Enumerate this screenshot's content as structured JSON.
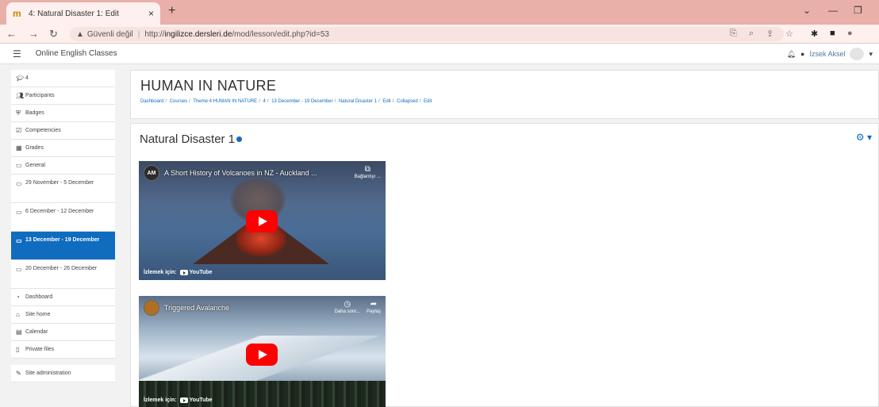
{
  "browser": {
    "tab_title": "4: Natural Disaster 1: Edit",
    "tab_close": "×",
    "new_tab": "+",
    "url_warning": "Güvenli değil",
    "url_prefix": "http://",
    "url_host": "ingilizce.dersleri.de",
    "url_path": "/mod/lesson/edit.php?id=53"
  },
  "navbar": {
    "site_name": "Online English Classes",
    "user_name": "İzsek Aksel"
  },
  "sidebar": {
    "items": [
      {
        "label": "4",
        "icon": "graduation-cap-icon"
      },
      {
        "label": "Participants",
        "icon": "users-icon"
      },
      {
        "label": "Badges",
        "icon": "shield-icon"
      },
      {
        "label": "Competencies",
        "icon": "check-square-icon"
      },
      {
        "label": "Grades",
        "icon": "table-icon"
      },
      {
        "label": "General",
        "icon": "folder-icon"
      },
      {
        "label": "29 November - 5 December",
        "icon": "folder-icon"
      },
      {
        "label": "6 December - 12 December",
        "icon": "folder-icon"
      },
      {
        "label": "13 December - 19 December",
        "icon": "folder-icon"
      },
      {
        "label": "20 December - 26 December",
        "icon": "folder-icon"
      },
      {
        "label": "Dashboard",
        "icon": "dashboard-icon"
      },
      {
        "label": "Site home",
        "icon": "home-icon"
      },
      {
        "label": "Calendar",
        "icon": "calendar-icon"
      },
      {
        "label": "Private files",
        "icon": "file-icon"
      },
      {
        "label": "Site administration",
        "icon": "wrench-icon"
      }
    ]
  },
  "header": {
    "title": "HUMAN IN NATURE",
    "breadcrumb": [
      "Dashboard",
      "Courses",
      "Theme 4 HUMAN IN NATURE",
      "4",
      "13 December - 19 December",
      "Natural Disaster 1",
      "Edit",
      "Collapsed",
      "Edit"
    ]
  },
  "lesson": {
    "title": "Natural Disaster 1"
  },
  "videos": [
    {
      "channel_initials": "AM",
      "title": "A Short History of Volcanoes in NZ - Auckland ...",
      "action_label": "Bağlantıyı ...",
      "watch_label": "İzlemek için:",
      "platform": "YouTube"
    },
    {
      "channel_initials": "",
      "title": "Triggered Avalanche",
      "action_label": "Daha sonr...",
      "action2_label": "Paylaş",
      "watch_label": "İzlemek için:",
      "platform": "YouTube"
    }
  ]
}
